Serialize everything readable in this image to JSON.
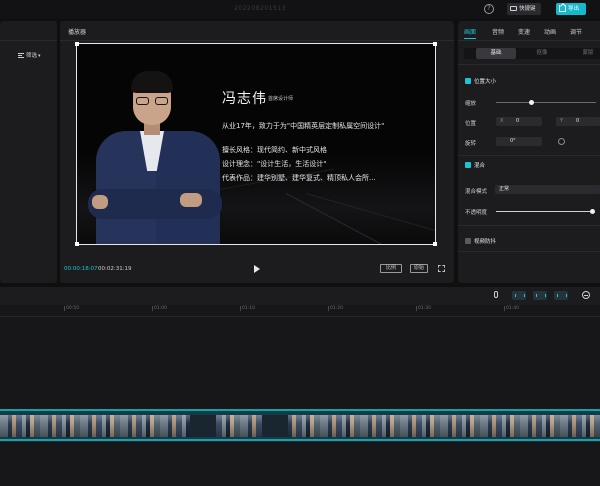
{
  "header": {
    "project_title": "202208201513",
    "help_icon": "help-icon",
    "shortcut_label": "快捷键",
    "export_label": "导出",
    "accent_color": "#16b8cc"
  },
  "media": {
    "sort_label": "筛选"
  },
  "player": {
    "title": "播放器",
    "card": {
      "name": "冯志伟",
      "role": "首席设计师",
      "line1": "从业17年，致力于为\"中国精英层定制私属空间设计\"",
      "line2": "擅长风格：现代简约、新中式风格",
      "line3": "设计理念：\"设计生活，生活设计\"",
      "line4": "代表作品：建华别墅、建华复式、精顶私人会所..."
    },
    "time_current": "00:00:18:07",
    "time_total": "00:02:31:19",
    "ratio_label": "比例",
    "original_label": "原始",
    "fullscreen_icon": "fullscreen-icon"
  },
  "properties": {
    "tabs": [
      "画面",
      "音频",
      "变速",
      "动画",
      "调节"
    ],
    "active_tab": 0,
    "subtabs": [
      "基础",
      "抠像",
      "蒙版"
    ],
    "active_subtab": 0,
    "position_size": {
      "title": "位置大小",
      "checked": true,
      "scale_label": "缩放",
      "scale_value": 0.35,
      "position_label": "位置",
      "x_label": "X",
      "x_value": "0",
      "y_label": "Y",
      "y_value": "0",
      "rotate_label": "旋转",
      "rotate_value": "0°"
    },
    "blend": {
      "title": "混合",
      "checked": true,
      "mode_label": "混合模式",
      "mode_value": "正常",
      "opacity_label": "不透明度",
      "opacity_value": 1.0
    },
    "stabilize": {
      "title": "视频防抖",
      "checked": false
    }
  },
  "timeline": {
    "ticks": [
      "00:50",
      "01:00",
      "01:10",
      "01:20",
      "01:30",
      "01:40"
    ],
    "mic_icon": "mic-icon",
    "zoom_icon": "zoom-out-icon"
  }
}
